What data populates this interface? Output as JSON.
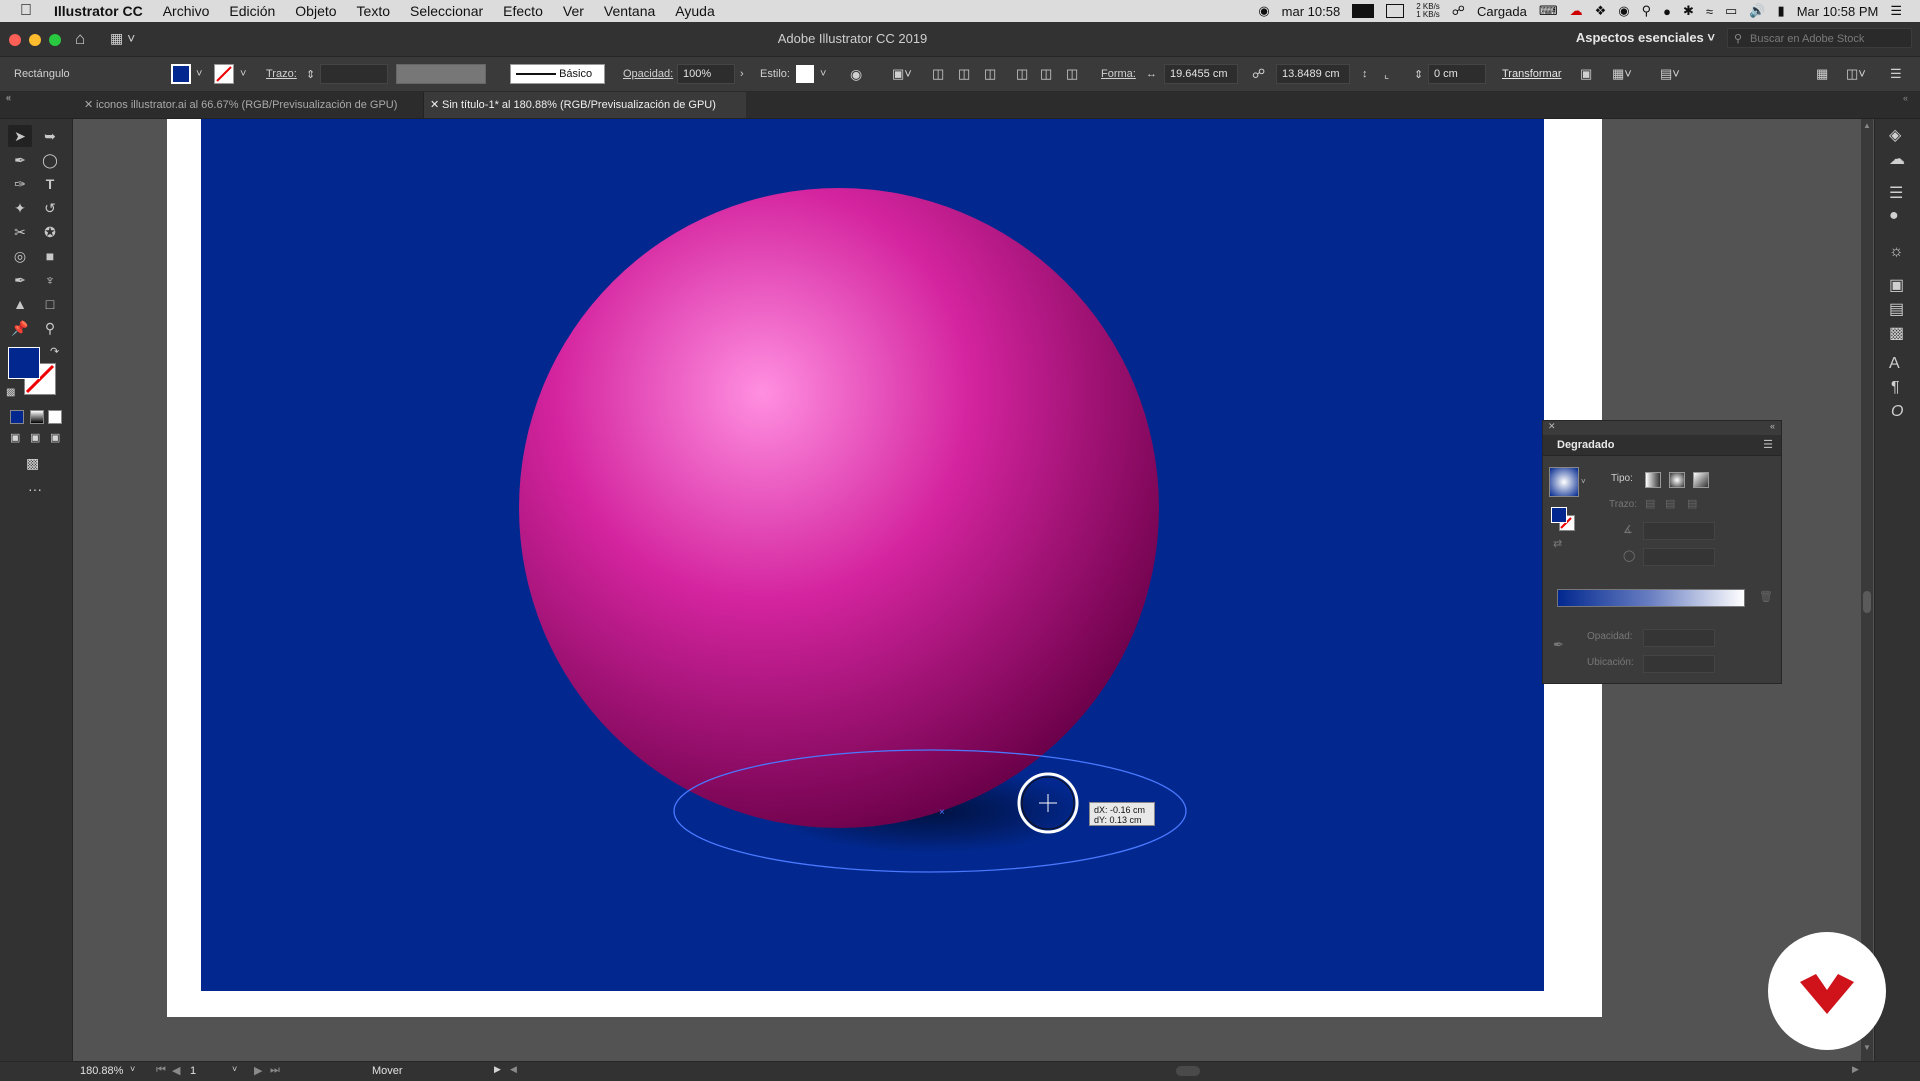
{
  "menubar": {
    "app_name": "Illustrator CC",
    "menus": [
      "Archivo",
      "Edición",
      "Objeto",
      "Texto",
      "Seleccionar",
      "Efecto",
      "Ver",
      "Ventana",
      "Ayuda"
    ],
    "clock_small": "mar 10:58",
    "net_up": "2 KB/s",
    "net_down": "1 KB/s",
    "battery_text": "Cargada",
    "clock": "Mar 10:58 PM"
  },
  "titlebar": {
    "title": "Adobe Illustrator CC 2019",
    "workspace": "Aspectos esenciales",
    "search_placeholder": "Buscar en Adobe Stock"
  },
  "controlbar": {
    "object_type": "Rectángulo",
    "fill_color": "#02288f",
    "stroke_label": "Trazo:",
    "brush_label": "Básico",
    "opacity_label": "Opacidad:",
    "opacity_value": "100%",
    "style_label": "Estilo:",
    "shape_label": "Forma:",
    "width_value": "19.6455 cm",
    "height_value": "13.8489 cm",
    "corner_value": "0 cm",
    "transform_label": "Transformar"
  },
  "tabs": [
    {
      "label": "iconos illustrator.ai al 66.67% (RGB/Previsualización de GPU)",
      "active": false
    },
    {
      "label": "Sin título-1* al 180.88% (RGB/Previsualización de GPU)",
      "active": true
    }
  ],
  "canvas": {
    "background_color": "#02288f",
    "sphere_colors": [
      "#ff8fe0",
      "#d4249f",
      "#6a0048"
    ],
    "measure_dx": "dX: -0.16 cm",
    "measure_dy": "dY: 0.13 cm"
  },
  "gradient_panel": {
    "title": "Degradado",
    "type_label": "Tipo:",
    "stroke_label": "Trazo:",
    "opacity_label": "Opacidad:",
    "location_label": "Ubicación:"
  },
  "statusbar": {
    "zoom": "180.88%",
    "artboard_num": "1",
    "tool_status": "Mover"
  }
}
